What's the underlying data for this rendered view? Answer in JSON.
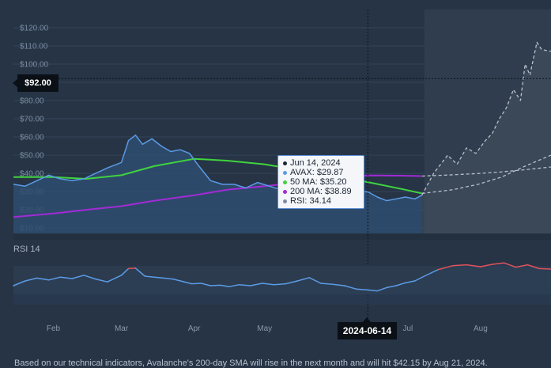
{
  "chart_data": [
    {
      "type": "line",
      "y_tick_labels": [
        "$120.00",
        "$110.00",
        "$100.00",
        "$90.00",
        "$80.00",
        "$70.00",
        "$60.00",
        "$50.00",
        "$40.00",
        "$30.00",
        "$20.00",
        "$10.00"
      ],
      "y_ticks": [
        120,
        110,
        100,
        90,
        80,
        70,
        60,
        50,
        40,
        30,
        20,
        10
      ],
      "ylim": [
        7,
        130
      ],
      "xlim": [
        "2024-01-15",
        "2024-08-31"
      ],
      "x_tick_labels": [
        "Feb",
        "Mar",
        "Apr",
        "May",
        "Jul",
        "Aug"
      ],
      "x_ticks": [
        "2024-02-01",
        "2024-03-01",
        "2024-04-01",
        "2024-05-01",
        "2024-07-01",
        "2024-08-01"
      ],
      "crosshair_price_label": "$92.00",
      "crosshair_price": 92,
      "crosshair_date_label": "2024-06-14",
      "crosshair_date": "2024-06-14",
      "forecast_start": "2024-07-08",
      "colors": {
        "avax": "#5b9be6",
        "ma50": "#3fd33f",
        "ma200": "#a22bd6",
        "forecast": "#b8c0cc",
        "rsi_overbought": "#e0525c"
      },
      "series": [
        {
          "name": "AVAX",
          "x": [
            "2024-01-15",
            "2024-01-20",
            "2024-01-25",
            "2024-01-30",
            "2024-02-04",
            "2024-02-09",
            "2024-02-14",
            "2024-02-19",
            "2024-02-24",
            "2024-03-01",
            "2024-03-04",
            "2024-03-07",
            "2024-03-10",
            "2024-03-14",
            "2024-03-18",
            "2024-03-22",
            "2024-03-26",
            "2024-03-30",
            "2024-04-03",
            "2024-04-08",
            "2024-04-13",
            "2024-04-18",
            "2024-04-23",
            "2024-04-28",
            "2024-05-03",
            "2024-05-08",
            "2024-05-13",
            "2024-05-18",
            "2024-05-23",
            "2024-05-28",
            "2024-06-02",
            "2024-06-07",
            "2024-06-11",
            "2024-06-14",
            "2024-06-18",
            "2024-06-22",
            "2024-06-26",
            "2024-06-30",
            "2024-07-04",
            "2024-07-07"
          ],
          "values": [
            34,
            33,
            36,
            39,
            37,
            36,
            37,
            40,
            43,
            46,
            58,
            61,
            56,
            59,
            55,
            52,
            53,
            51,
            44,
            36,
            34,
            34,
            32,
            35,
            33,
            31,
            34,
            36,
            38,
            37,
            33,
            31,
            30,
            29.87,
            27,
            25,
            26,
            27,
            26,
            28
          ]
        },
        {
          "name": "50 MA",
          "x": [
            "2024-01-15",
            "2024-02-01",
            "2024-02-15",
            "2024-03-01",
            "2024-03-15",
            "2024-04-01",
            "2024-04-15",
            "2024-05-01",
            "2024-05-15",
            "2024-06-01",
            "2024-06-14",
            "2024-06-30",
            "2024-07-07"
          ],
          "values": [
            38,
            38,
            37,
            39,
            44,
            48,
            47,
            45,
            42,
            38,
            35.2,
            31,
            29
          ]
        },
        {
          "name": "200 MA",
          "x": [
            "2024-01-15",
            "2024-02-01",
            "2024-02-15",
            "2024-03-01",
            "2024-03-15",
            "2024-04-01",
            "2024-04-15",
            "2024-05-01",
            "2024-05-15",
            "2024-06-01",
            "2024-06-14",
            "2024-06-30",
            "2024-07-07"
          ],
          "values": [
            16,
            18,
            20,
            22,
            25,
            28,
            31,
            33,
            35,
            37,
            38.89,
            38.7,
            38.5
          ]
        },
        {
          "name": "AVAX forecast",
          "x": [
            "2024-07-07",
            "2024-07-12",
            "2024-07-18",
            "2024-07-22",
            "2024-07-26",
            "2024-07-30",
            "2024-08-03",
            "2024-08-06",
            "2024-08-09",
            "2024-08-12",
            "2024-08-15",
            "2024-08-18",
            "2024-08-20",
            "2024-08-22",
            "2024-08-25",
            "2024-08-27",
            "2024-08-31"
          ],
          "values": [
            28,
            40,
            50,
            45,
            54,
            51,
            58,
            62,
            70,
            76,
            86,
            80,
            100,
            94,
            112,
            108,
            107
          ]
        },
        {
          "name": "200 MA forecast",
          "x": [
            "2024-07-07",
            "2024-07-20",
            "2024-08-01",
            "2024-08-10",
            "2024-08-21",
            "2024-08-31"
          ],
          "values": [
            38.5,
            39.2,
            40,
            40.8,
            42.15,
            43.5
          ]
        },
        {
          "name": "50 MA forecast",
          "x": [
            "2024-07-07",
            "2024-07-20",
            "2024-07-31",
            "2024-08-10",
            "2024-08-20",
            "2024-08-31"
          ],
          "values": [
            29,
            31,
            34,
            38,
            44,
            50
          ]
        }
      ]
    },
    {
      "type": "line",
      "title": "RSI 14",
      "ylim": [
        0,
        100
      ],
      "series": [
        {
          "name": "RSI",
          "x": [
            "2024-01-15",
            "2024-01-20",
            "2024-01-25",
            "2024-01-30",
            "2024-02-04",
            "2024-02-09",
            "2024-02-14",
            "2024-02-19",
            "2024-02-24",
            "2024-03-01",
            "2024-03-04",
            "2024-03-07",
            "2024-03-11",
            "2024-03-15",
            "2024-03-19",
            "2024-03-23",
            "2024-03-27",
            "2024-03-31",
            "2024-04-04",
            "2024-04-08",
            "2024-04-12",
            "2024-04-16",
            "2024-04-20",
            "2024-04-25",
            "2024-04-30",
            "2024-05-05",
            "2024-05-10",
            "2024-05-15",
            "2024-05-20",
            "2024-05-25",
            "2024-05-30",
            "2024-06-04",
            "2024-06-09",
            "2024-06-14",
            "2024-06-18",
            "2024-06-22",
            "2024-06-26",
            "2024-06-30",
            "2024-07-04",
            "2024-07-08",
            "2024-07-14",
            "2024-07-20",
            "2024-07-26",
            "2024-08-01",
            "2024-08-06",
            "2024-08-11",
            "2024-08-16",
            "2024-08-21",
            "2024-08-26",
            "2024-08-31"
          ],
          "values": [
            40,
            50,
            56,
            52,
            58,
            55,
            62,
            54,
            48,
            62,
            76,
            77,
            60,
            58,
            56,
            54,
            49,
            44,
            45,
            40,
            41,
            38,
            42,
            40,
            45,
            42,
            44,
            50,
            57,
            45,
            43,
            40,
            33,
            31,
            29,
            36,
            40,
            46,
            50,
            60,
            74,
            82,
            84,
            80,
            85,
            88,
            79,
            84,
            76,
            75
          ]
        }
      ]
    }
  ],
  "tooltip": {
    "date": "Jun 14, 2024",
    "avax": "AVAX: $29.87",
    "ma50": "50 MA: $35.20",
    "ma200": "200 MA: $38.89",
    "rsi": "RSI: 34.14"
  },
  "rsi_panel": {
    "label": "RSI 14"
  },
  "footer_text": "Based on our technical indicators, Avalanche's 200-day SMA will rise in the next month and will hit $42.15 by Aug 21, 2024."
}
